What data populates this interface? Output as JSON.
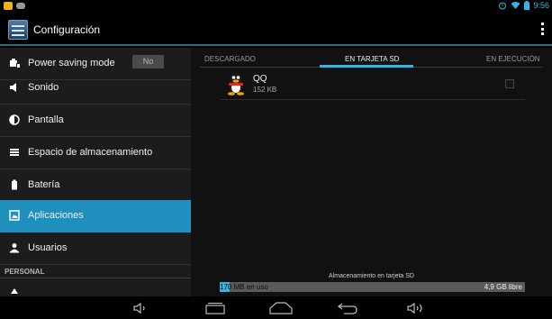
{
  "status_bar": {
    "time": "9:56",
    "icons": [
      "app-notification-icon",
      "chat-notification-icon",
      "alarm-icon",
      "wifi-icon",
      "battery-icon"
    ]
  },
  "action_bar": {
    "title": "Configuración",
    "icon": "settings-icon",
    "overflow": "overflow-menu-icon"
  },
  "sidebar": {
    "items": [
      {
        "label": "Power saving mode",
        "icon": "battery-saver-icon",
        "toggle": "No"
      },
      {
        "label": "Sonido",
        "icon": "speaker-icon"
      },
      {
        "label": "Pantalla",
        "icon": "display-icon"
      },
      {
        "label": "Espacio de almacenamiento",
        "icon": "storage-icon"
      },
      {
        "label": "Batería",
        "icon": "battery-icon"
      },
      {
        "label": "Aplicaciones",
        "icon": "apps-icon",
        "active": true
      },
      {
        "label": "Usuarios",
        "icon": "user-icon"
      }
    ],
    "section_personal": "PERSONAL"
  },
  "content": {
    "tabs": [
      {
        "label": "DESCARGADO"
      },
      {
        "label": "EN TARJETA SD",
        "selected": true
      },
      {
        "label": "EN EJECUCIÓN"
      }
    ],
    "apps": [
      {
        "name": "QQ",
        "size": "152 KB",
        "icon": "qq-penguin-icon",
        "checked": false
      }
    ],
    "storage": {
      "title": "Almacenamiento en tarjeta SD",
      "used": "170 MB en uso",
      "free": "4,9 GB libre",
      "used_fraction": 0.033
    }
  },
  "nav_bar": {
    "buttons": [
      "volume-down-icon",
      "recent-apps-icon",
      "home-icon",
      "back-icon",
      "volume-up-icon"
    ]
  },
  "colors": {
    "accent": "#33b5e5",
    "active_item": "#1f8fbd",
    "sidebar_bg": "#1c1c1c",
    "content_bg": "#111111"
  }
}
